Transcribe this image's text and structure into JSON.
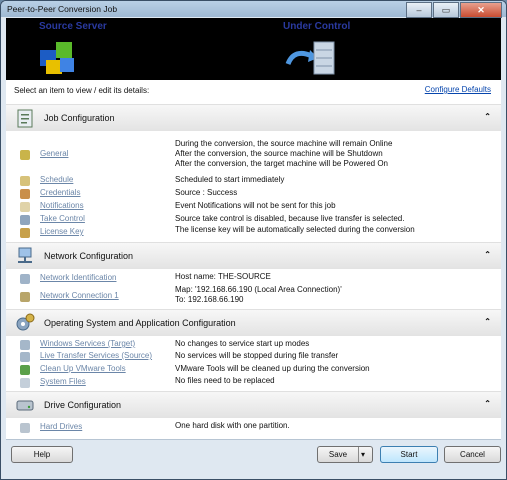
{
  "window": {
    "title": "Peer-to-Peer Conversion Job",
    "min_glyph": "‒",
    "max_glyph": "▭",
    "close_glyph": "✕"
  },
  "banner": {
    "source_label": "Source Server",
    "control_label": "Under Control"
  },
  "content": {
    "prompt": "Select an item to view / edit its details:",
    "configure_defaults": "Configure Defaults"
  },
  "sections": {
    "job": {
      "title": "Job Configuration",
      "chevron": "⌃"
    },
    "network": {
      "title": "Network Configuration",
      "chevron": "⌃"
    },
    "os": {
      "title": "Operating System and Application Configuration",
      "chevron": "⌃"
    },
    "drive": {
      "title": "Drive Configuration",
      "chevron": "⌃"
    }
  },
  "job_items": [
    {
      "label": "General",
      "desc": [
        "During the conversion, the source machine will remain Online",
        "After the conversion, the source machine will be Shutdown",
        "After the conversion, the target machine will be Powered On"
      ]
    },
    {
      "label": "Schedule",
      "desc": "Scheduled to start immediately"
    },
    {
      "label": "Credentials",
      "desc": "Source : Success"
    },
    {
      "label": "Notifications",
      "desc": "Event Notifications will not be sent for this job"
    },
    {
      "label": "Take Control",
      "desc": "Source take control is disabled, because live transfer is selected."
    },
    {
      "label": "License Key",
      "desc": "The license key will be automatically selected during the conversion"
    }
  ],
  "network_items": [
    {
      "label": "Network Identification",
      "desc": "Host name: THE-SOURCE"
    },
    {
      "label": "Network Connection 1",
      "desc": [
        "Map: '192.168.66.190 (Local Area Connection)'",
        "To: 192.168.66.190"
      ]
    }
  ],
  "os_items": [
    {
      "label": "Windows Services (Target)",
      "desc": "No changes to service start up modes"
    },
    {
      "label": "Live Transfer Services (Source)",
      "desc": "No services will be stopped during file transfer"
    },
    {
      "label": "Clean Up VMware Tools",
      "desc": "VMware Tools will be cleaned up during the conversion"
    },
    {
      "label": "System Files",
      "desc": "No files need to be replaced"
    }
  ],
  "drive_items": [
    {
      "label": "Hard Drives",
      "desc": "One hard disk with one partition."
    }
  ],
  "buttons": {
    "help": "Help",
    "save": "Save",
    "save_arrow": "▾",
    "start": "Start",
    "cancel": "Cancel"
  }
}
